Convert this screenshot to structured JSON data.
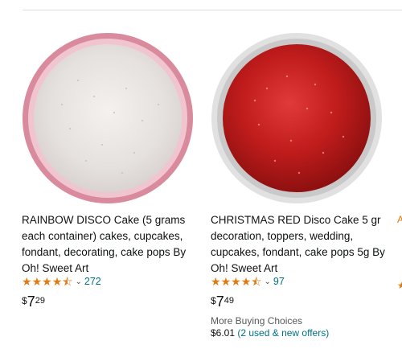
{
  "products": [
    {
      "title": "RAINBOW DISCO Cake (5 grams each container) cakes, cupcakes, fondant, decorating, cake pops By Oh! Sweet Art",
      "rating_stars": 4.5,
      "review_count": "272",
      "price_symbol": "$",
      "price_whole": "7",
      "price_fraction": "29",
      "image_colors": {
        "rim": "#d98a9c",
        "fill": "#e9e4e1",
        "inner_rim": "#f2c9d1"
      }
    },
    {
      "title": "CHRISTMAS RED Disco Cake 5 gr decoration, toppers, wedding, cupcakes, fondant, cake pops 5g By Oh! Sweet Art",
      "rating_stars": 4.5,
      "review_count": "97",
      "price_symbol": "$",
      "price_whole": "7",
      "price_fraction": "49",
      "more_buying_choices": "More Buying Choices",
      "offer_price": "$6.01",
      "offer_link": "(2 used & new offers)",
      "image_colors": {
        "rim": "#d9d9d9",
        "fill": "#c01c1c"
      }
    }
  ],
  "colors": {
    "star": "#e47911",
    "link": "#007185",
    "muted": "#565959"
  }
}
